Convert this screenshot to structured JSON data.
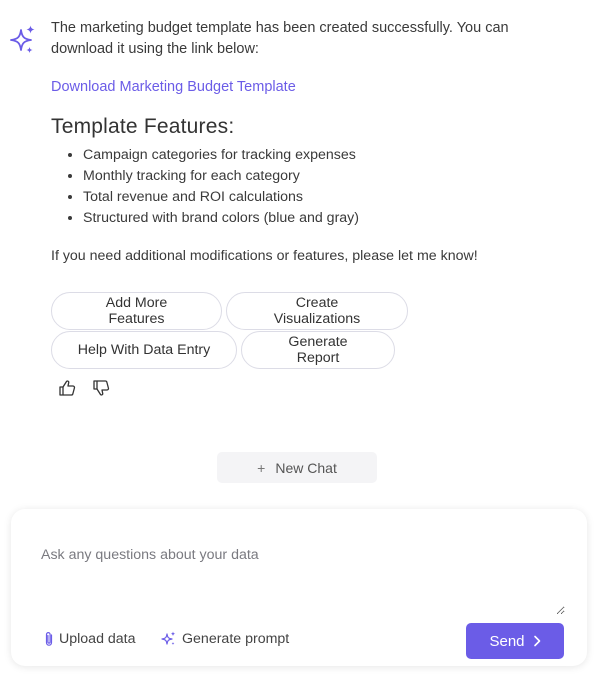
{
  "accent_color": "#6b5ce7",
  "message": {
    "avatar_icon": "sparkle-icon",
    "intro": "The marketing budget template has been created successfully. You can download it using the link below:",
    "download_link": "Download Marketing Budget Template",
    "features_heading": "Template Features:",
    "features": [
      "Campaign categories for tracking expenses",
      "Monthly tracking for each category",
      "Total revenue and ROI calculations",
      "Structured with brand colors (blue and gray)"
    ],
    "closing": "If you need additional modifications or features, please let me know!"
  },
  "suggestions": [
    "Add More Features",
    "Create Visualizations",
    "Help With Data Entry",
    "Generate Report"
  ],
  "feedback": {
    "like_icon": "thumbs-up-icon",
    "dislike_icon": "thumbs-down-icon"
  },
  "new_chat": {
    "icon": "plus-icon",
    "label": "New Chat"
  },
  "composer": {
    "placeholder": "Ask any questions about your data",
    "value": "",
    "upload_label": "Upload data",
    "upload_icon": "paperclip-icon",
    "generate_label": "Generate prompt",
    "generate_icon": "sparkle-icon",
    "send_label": "Send",
    "send_icon": "chevron-right-icon"
  }
}
